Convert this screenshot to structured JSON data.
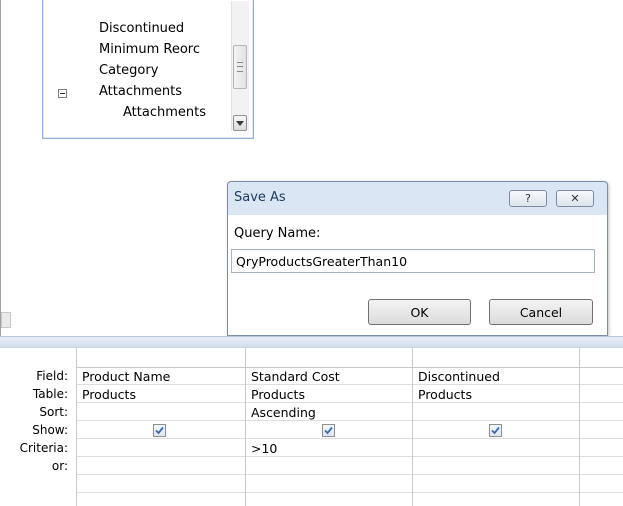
{
  "field_list": {
    "items": [
      {
        "label": "Discontinued",
        "indent": 0
      },
      {
        "label": "Minimum Reorc",
        "indent": 0
      },
      {
        "label": "Category",
        "indent": 0
      },
      {
        "label": "Attachments",
        "indent": 0,
        "expander": "collapse-icon"
      },
      {
        "label": "Attachments",
        "indent": 1
      }
    ]
  },
  "dialog": {
    "title": "Save As",
    "help_glyph": "?",
    "close_glyph": "✕",
    "label": "Query Name:",
    "input_value": "QryProductsGreaterThan10",
    "ok_label": "OK",
    "cancel_label": "Cancel"
  },
  "grid": {
    "row_labels": [
      "Field:",
      "Table:",
      "Sort:",
      "Show:",
      "Criteria:",
      "or:"
    ],
    "columns": [
      {
        "field": "Product Name",
        "table": "Products",
        "sort": "",
        "show": true,
        "criteria": "",
        "or": ""
      },
      {
        "field": "Standard Cost",
        "table": "Products",
        "sort": "Ascending",
        "show": true,
        "criteria": ">10",
        "or": ""
      },
      {
        "field": "Discontinued",
        "table": "Products",
        "sort": "",
        "show": true,
        "criteria": "",
        "or": ""
      }
    ]
  },
  "colors": {
    "dialog_frame": "#dbe6f4",
    "title_text": "#1e395b",
    "check_mark": "#3c6db0"
  }
}
